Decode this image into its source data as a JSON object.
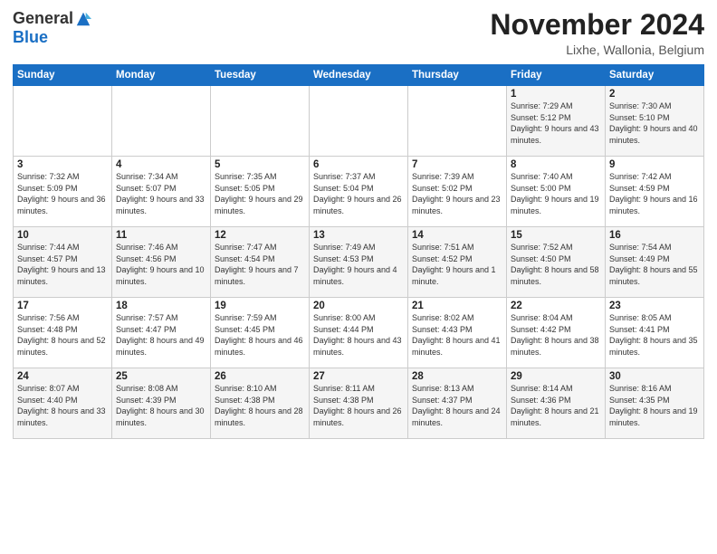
{
  "header": {
    "logo_general": "General",
    "logo_blue": "Blue",
    "month_title": "November 2024",
    "location": "Lixhe, Wallonia, Belgium"
  },
  "weekdays": [
    "Sunday",
    "Monday",
    "Tuesday",
    "Wednesday",
    "Thursday",
    "Friday",
    "Saturday"
  ],
  "weeks": [
    [
      {
        "day": "",
        "info": ""
      },
      {
        "day": "",
        "info": ""
      },
      {
        "day": "",
        "info": ""
      },
      {
        "day": "",
        "info": ""
      },
      {
        "day": "",
        "info": ""
      },
      {
        "day": "1",
        "info": "Sunrise: 7:29 AM\nSunset: 5:12 PM\nDaylight: 9 hours and 43 minutes."
      },
      {
        "day": "2",
        "info": "Sunrise: 7:30 AM\nSunset: 5:10 PM\nDaylight: 9 hours and 40 minutes."
      }
    ],
    [
      {
        "day": "3",
        "info": "Sunrise: 7:32 AM\nSunset: 5:09 PM\nDaylight: 9 hours and 36 minutes."
      },
      {
        "day": "4",
        "info": "Sunrise: 7:34 AM\nSunset: 5:07 PM\nDaylight: 9 hours and 33 minutes."
      },
      {
        "day": "5",
        "info": "Sunrise: 7:35 AM\nSunset: 5:05 PM\nDaylight: 9 hours and 29 minutes."
      },
      {
        "day": "6",
        "info": "Sunrise: 7:37 AM\nSunset: 5:04 PM\nDaylight: 9 hours and 26 minutes."
      },
      {
        "day": "7",
        "info": "Sunrise: 7:39 AM\nSunset: 5:02 PM\nDaylight: 9 hours and 23 minutes."
      },
      {
        "day": "8",
        "info": "Sunrise: 7:40 AM\nSunset: 5:00 PM\nDaylight: 9 hours and 19 minutes."
      },
      {
        "day": "9",
        "info": "Sunrise: 7:42 AM\nSunset: 4:59 PM\nDaylight: 9 hours and 16 minutes."
      }
    ],
    [
      {
        "day": "10",
        "info": "Sunrise: 7:44 AM\nSunset: 4:57 PM\nDaylight: 9 hours and 13 minutes."
      },
      {
        "day": "11",
        "info": "Sunrise: 7:46 AM\nSunset: 4:56 PM\nDaylight: 9 hours and 10 minutes."
      },
      {
        "day": "12",
        "info": "Sunrise: 7:47 AM\nSunset: 4:54 PM\nDaylight: 9 hours and 7 minutes."
      },
      {
        "day": "13",
        "info": "Sunrise: 7:49 AM\nSunset: 4:53 PM\nDaylight: 9 hours and 4 minutes."
      },
      {
        "day": "14",
        "info": "Sunrise: 7:51 AM\nSunset: 4:52 PM\nDaylight: 9 hours and 1 minute."
      },
      {
        "day": "15",
        "info": "Sunrise: 7:52 AM\nSunset: 4:50 PM\nDaylight: 8 hours and 58 minutes."
      },
      {
        "day": "16",
        "info": "Sunrise: 7:54 AM\nSunset: 4:49 PM\nDaylight: 8 hours and 55 minutes."
      }
    ],
    [
      {
        "day": "17",
        "info": "Sunrise: 7:56 AM\nSunset: 4:48 PM\nDaylight: 8 hours and 52 minutes."
      },
      {
        "day": "18",
        "info": "Sunrise: 7:57 AM\nSunset: 4:47 PM\nDaylight: 8 hours and 49 minutes."
      },
      {
        "day": "19",
        "info": "Sunrise: 7:59 AM\nSunset: 4:45 PM\nDaylight: 8 hours and 46 minutes."
      },
      {
        "day": "20",
        "info": "Sunrise: 8:00 AM\nSunset: 4:44 PM\nDaylight: 8 hours and 43 minutes."
      },
      {
        "day": "21",
        "info": "Sunrise: 8:02 AM\nSunset: 4:43 PM\nDaylight: 8 hours and 41 minutes."
      },
      {
        "day": "22",
        "info": "Sunrise: 8:04 AM\nSunset: 4:42 PM\nDaylight: 8 hours and 38 minutes."
      },
      {
        "day": "23",
        "info": "Sunrise: 8:05 AM\nSunset: 4:41 PM\nDaylight: 8 hours and 35 minutes."
      }
    ],
    [
      {
        "day": "24",
        "info": "Sunrise: 8:07 AM\nSunset: 4:40 PM\nDaylight: 8 hours and 33 minutes."
      },
      {
        "day": "25",
        "info": "Sunrise: 8:08 AM\nSunset: 4:39 PM\nDaylight: 8 hours and 30 minutes."
      },
      {
        "day": "26",
        "info": "Sunrise: 8:10 AM\nSunset: 4:38 PM\nDaylight: 8 hours and 28 minutes."
      },
      {
        "day": "27",
        "info": "Sunrise: 8:11 AM\nSunset: 4:38 PM\nDaylight: 8 hours and 26 minutes."
      },
      {
        "day": "28",
        "info": "Sunrise: 8:13 AM\nSunset: 4:37 PM\nDaylight: 8 hours and 24 minutes."
      },
      {
        "day": "29",
        "info": "Sunrise: 8:14 AM\nSunset: 4:36 PM\nDaylight: 8 hours and 21 minutes."
      },
      {
        "day": "30",
        "info": "Sunrise: 8:16 AM\nSunset: 4:35 PM\nDaylight: 8 hours and 19 minutes."
      }
    ]
  ]
}
